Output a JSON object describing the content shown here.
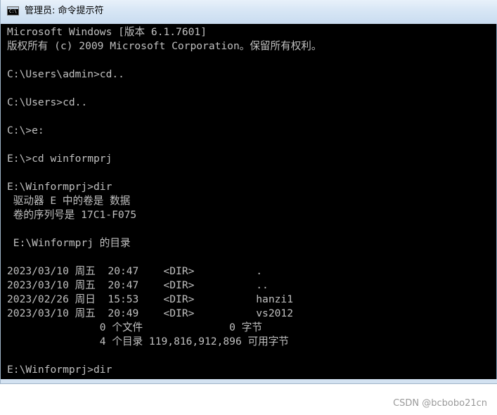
{
  "window": {
    "title": "管理员: 命令提示符",
    "icon": "cmd-icon"
  },
  "console": {
    "lines": [
      "Microsoft Windows [版本 6.1.7601]",
      "版权所有 (c) 2009 Microsoft Corporation。保留所有权利。",
      "",
      "C:\\Users\\admin>cd..",
      "",
      "C:\\Users>cd..",
      "",
      "C:\\>e:",
      "",
      "E:\\>cd winformprj",
      "",
      "E:\\Winformprj>dir",
      " 驱动器 E 中的卷是 数据",
      " 卷的序列号是 17C1-F075",
      "",
      " E:\\Winformprj 的目录",
      "",
      "2023/03/10 周五  20:47    <DIR>          .",
      "2023/03/10 周五  20:47    <DIR>          ..",
      "2023/02/26 周日  15:53    <DIR>          hanzi1",
      "2023/03/10 周五  20:49    <DIR>          vs2012",
      "               0 个文件              0 字节",
      "               4 个目录 119,816,912,896 可用字节",
      "",
      "E:\\Winformprj>dir"
    ]
  },
  "watermark": "CSDN @bcbobo21cn"
}
